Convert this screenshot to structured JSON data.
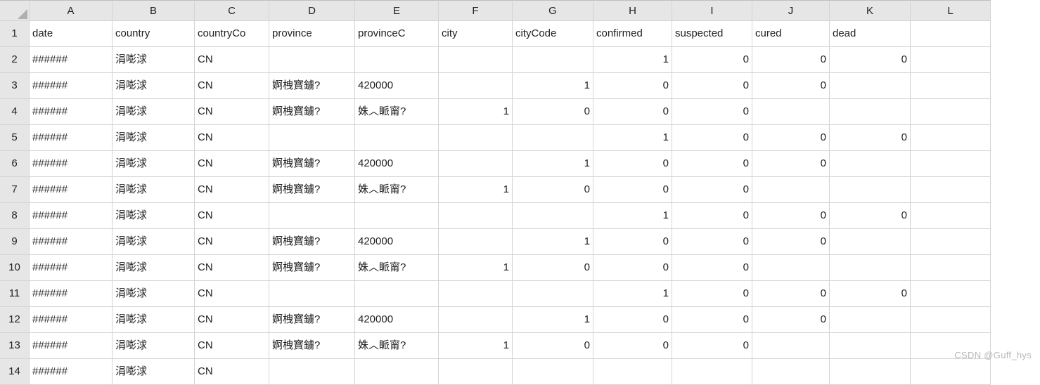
{
  "watermark": "CSDN @Guff_hys",
  "columns": [
    "",
    "A",
    "B",
    "C",
    "D",
    "E",
    "F",
    "G",
    "H",
    "I",
    "J",
    "K",
    "L"
  ],
  "rowNumbers": [
    "1",
    "2",
    "3",
    "4",
    "5",
    "6",
    "7",
    "8",
    "9",
    "10",
    "11",
    "12",
    "13",
    "14"
  ],
  "headerRow": [
    "date",
    "country",
    "countryCo",
    "province",
    "provinceC",
    "city",
    "cityCode",
    "confirmed",
    "suspected",
    "cured",
    "dead",
    ""
  ],
  "rows": [
    [
      "######",
      "涓嘭浗",
      "CN",
      "",
      "",
      "",
      "",
      "1",
      "0",
      "0",
      "0",
      ""
    ],
    [
      "######",
      "涓嘭浗",
      "CN",
      "婀栧寳鐪?",
      "420000",
      "",
      "1",
      "0",
      "0",
      "0",
      "",
      ""
    ],
    [
      "######",
      "涓嘭浗",
      "CN",
      "婀栧寳鐪?",
      "姝︿眽甯?",
      "1",
      "0",
      "0",
      "0",
      "",
      "",
      ""
    ],
    [
      "######",
      "涓嘭浗",
      "CN",
      "",
      "",
      "",
      "",
      "1",
      "0",
      "0",
      "0",
      ""
    ],
    [
      "######",
      "涓嘭浗",
      "CN",
      "婀栧寳鐪?",
      "420000",
      "",
      "1",
      "0",
      "0",
      "0",
      "",
      ""
    ],
    [
      "######",
      "涓嘭浗",
      "CN",
      "婀栧寳鐪?",
      "姝︿眽甯?",
      "1",
      "0",
      "0",
      "0",
      "",
      "",
      ""
    ],
    [
      "######",
      "涓嘭浗",
      "CN",
      "",
      "",
      "",
      "",
      "1",
      "0",
      "0",
      "0",
      ""
    ],
    [
      "######",
      "涓嘭浗",
      "CN",
      "婀栧寳鐪?",
      "420000",
      "",
      "1",
      "0",
      "0",
      "0",
      "",
      ""
    ],
    [
      "######",
      "涓嘭浗",
      "CN",
      "婀栧寳鐪?",
      "姝︿眽甯?",
      "1",
      "0",
      "0",
      "0",
      "",
      "",
      ""
    ],
    [
      "######",
      "涓嘭浗",
      "CN",
      "",
      "",
      "",
      "",
      "1",
      "0",
      "0",
      "0",
      ""
    ],
    [
      "######",
      "涓嘭浗",
      "CN",
      "婀栧寳鐪?",
      "420000",
      "",
      "1",
      "0",
      "0",
      "0",
      "",
      ""
    ],
    [
      "######",
      "涓嘭浗",
      "CN",
      "婀栧寳鐪?",
      "姝︿眽甯?",
      "1",
      "0",
      "0",
      "0",
      "",
      "",
      ""
    ],
    [
      "######",
      "涓嘭浗",
      "CN",
      "",
      "",
      "",
      "",
      "",
      "",
      "",
      "",
      ""
    ]
  ],
  "numericCols": [
    5,
    6,
    7,
    8,
    9,
    10
  ]
}
